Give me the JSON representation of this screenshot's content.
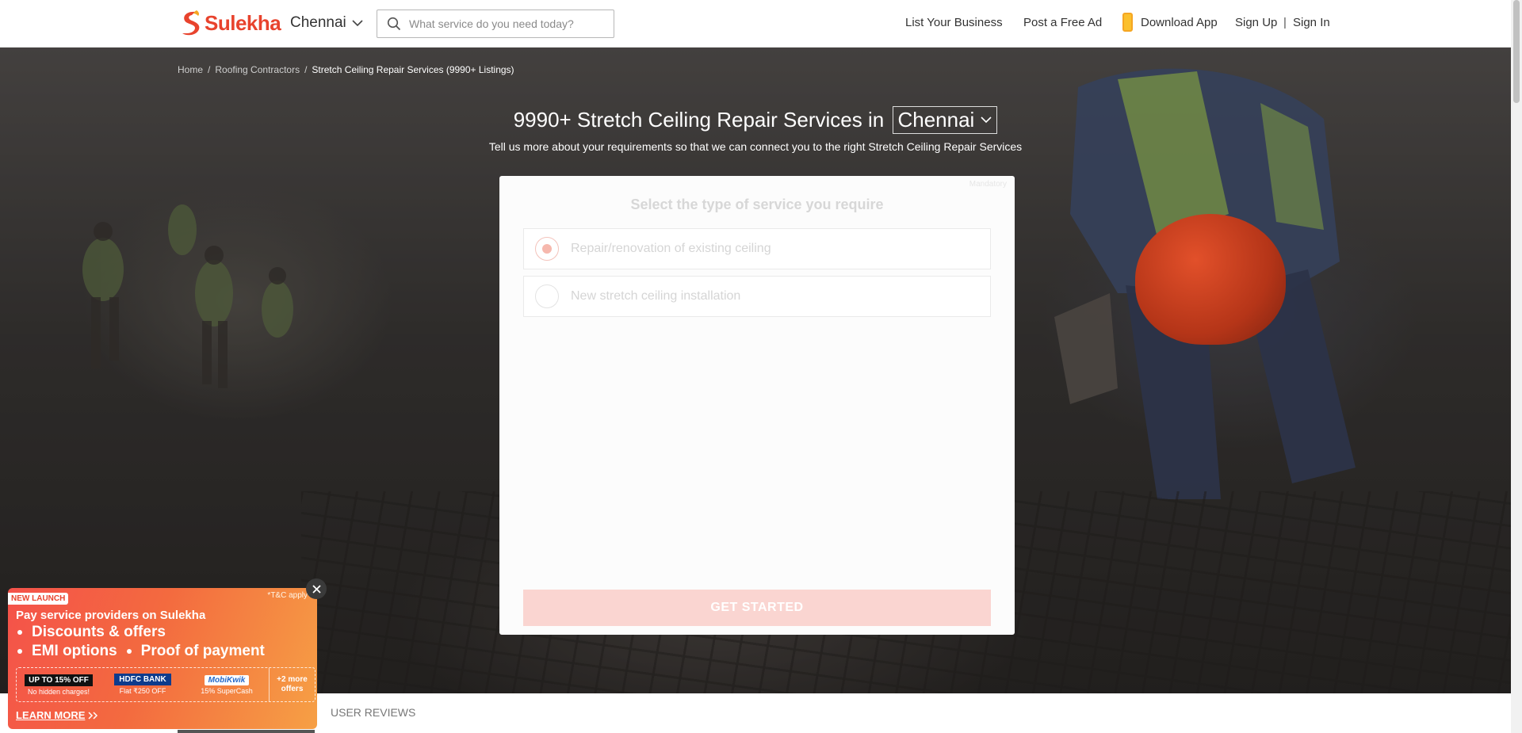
{
  "header": {
    "brand": "Sulekha",
    "city": "Chennai",
    "search_placeholder": "What service do you need today?",
    "nav": {
      "list_business": "List Your Business",
      "post_ad": "Post a Free Ad",
      "download_app": "Download App",
      "sign_up": "Sign Up",
      "separator": "|",
      "sign_in": "Sign In"
    }
  },
  "breadcrumb": {
    "home": "Home",
    "category": "Roofing Contractors",
    "current": "Stretch Ceiling Repair Services (9990+ Listings)",
    "sep": "/"
  },
  "hero": {
    "title_prefix": "9990+ Stretch Ceiling Repair Services in",
    "city": "Chennai",
    "subtitle": "Tell us more about your requirements so that we can connect you to the right Stretch Ceiling Repair Services"
  },
  "form": {
    "mandatory": "Mandatory",
    "question": "Select the type of service you require",
    "options": [
      {
        "label": "Repair/renovation of existing ceiling",
        "selected": true
      },
      {
        "label": "New stretch ceiling installation",
        "selected": false
      }
    ],
    "cta": "GET STARTED"
  },
  "tabs": {
    "reviews": "USER REVIEWS"
  },
  "promo": {
    "badge": "NEW LAUNCH",
    "tc": "*T&C apply",
    "title": "Pay service providers on Sulekha",
    "features_line1": "Discounts & offers",
    "features_line2a": "EMI options",
    "features_line2b": "Proof of payment",
    "offers": [
      {
        "tag": "UP TO 15% OFF",
        "sub": "No hidden charges!"
      },
      {
        "tag": "HDFC BANK",
        "sub": "Flat ₹250 OFF"
      },
      {
        "tag": "MobiKwik",
        "sub": "15% SuperCash"
      }
    ],
    "more_offers": "+2 more offers",
    "learn_more": "LEARN MORE",
    "colors": {
      "start": "#f4524a",
      "end": "#f6a045"
    }
  },
  "colors": {
    "brand": "#e8432d",
    "cta_disabled": "#fad5d1"
  }
}
